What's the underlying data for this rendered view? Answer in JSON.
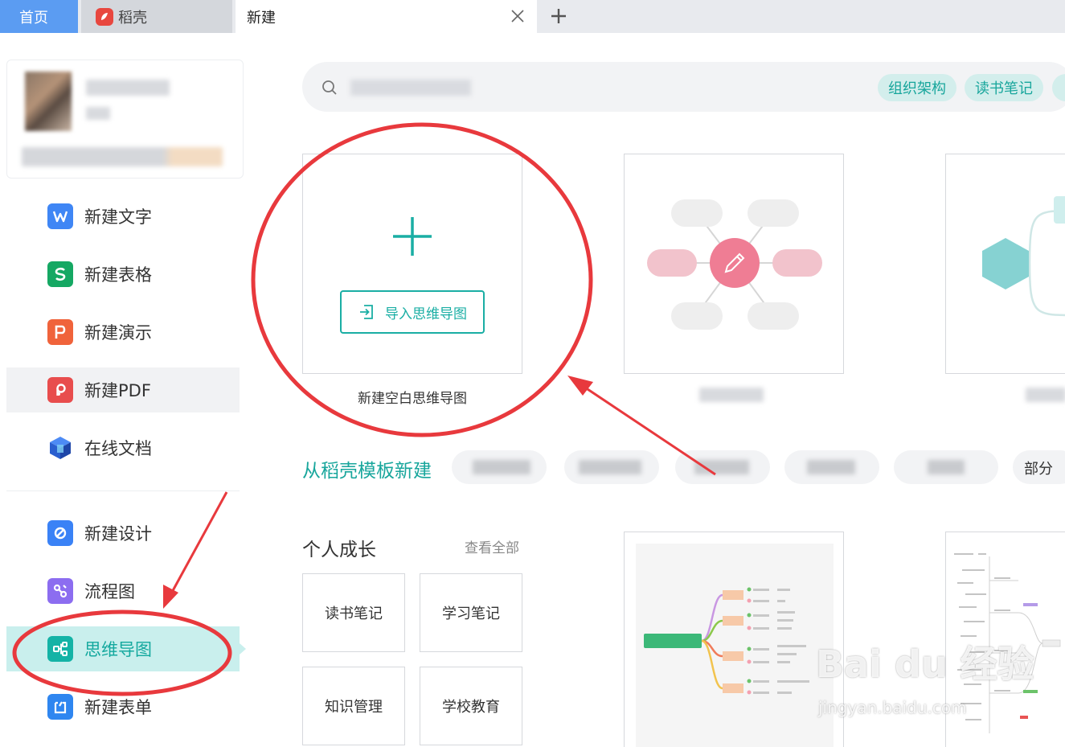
{
  "tabs": {
    "home": "首页",
    "docer": "稻壳",
    "new": "新建"
  },
  "sidebar": {
    "items": [
      {
        "label": "新建文字",
        "icon": "wps-writer-icon",
        "color": "#3f86f5"
      },
      {
        "label": "新建表格",
        "icon": "wps-spreadsheet-icon",
        "color": "#15a863"
      },
      {
        "label": "新建演示",
        "icon": "wps-presentation-icon",
        "color": "#f0633b"
      },
      {
        "label": "新建PDF",
        "icon": "pdf-icon",
        "color": "#e84d4d"
      },
      {
        "label": "在线文档",
        "icon": "online-doc-icon",
        "color": "#2f6fe8"
      },
      {
        "label": "新建设计",
        "icon": "design-icon",
        "color": "#3a82f6"
      },
      {
        "label": "流程图",
        "icon": "flowchart-icon",
        "color": "#8c6df0"
      },
      {
        "label": "思维导图",
        "icon": "mindmap-icon",
        "color": "#14b3a6"
      },
      {
        "label": "新建表单",
        "icon": "form-icon",
        "color": "#2f86f0"
      }
    ]
  },
  "search": {
    "tags": [
      "组织架构",
      "读书笔记"
    ]
  },
  "cards": {
    "blank": {
      "import_label": "导入思维导图",
      "caption": "新建空白思维导图"
    }
  },
  "templates": {
    "title": "从稻壳模板新建",
    "partial_chip": "部分",
    "group": {
      "title": "个人成长",
      "view_all": "查看全部",
      "categories": [
        "读书笔记",
        "学习笔记",
        "知识管理",
        "学校教育"
      ]
    }
  },
  "watermark": {
    "main": "Bai du 经验",
    "sub": "jingyan.baidu.com"
  },
  "colors": {
    "accent": "#18a69c",
    "annotation": "#e8393d",
    "home_tab": "#5b9cf2"
  }
}
